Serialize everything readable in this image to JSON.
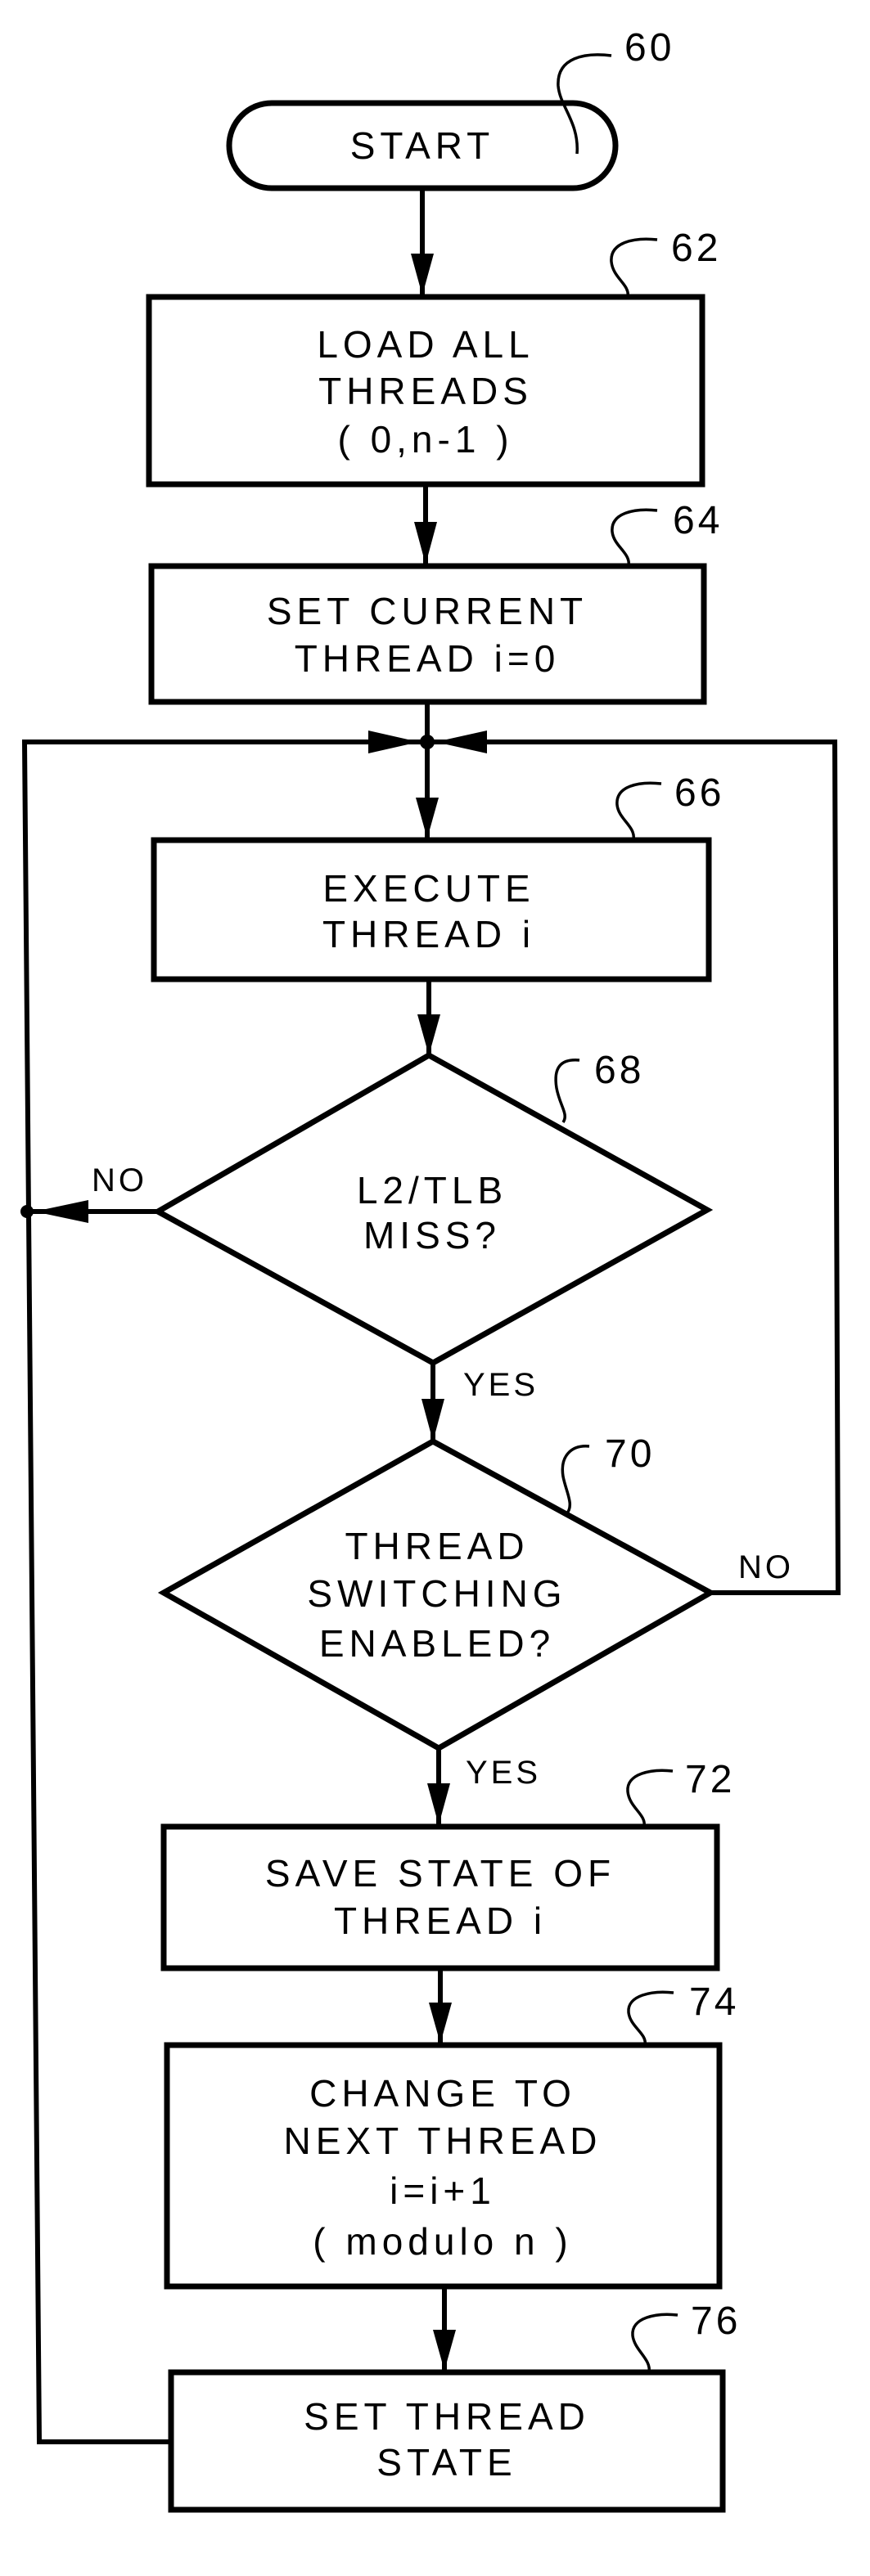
{
  "diagram": {
    "type": "flowchart",
    "nodes": [
      {
        "id": "60",
        "kind": "terminal",
        "ref": "60",
        "lines": [
          "START"
        ]
      },
      {
        "id": "62",
        "kind": "process",
        "ref": "62",
        "lines": [
          "LOAD ALL",
          "THREADS",
          "( 0,n-1 )"
        ]
      },
      {
        "id": "64",
        "kind": "process",
        "ref": "64",
        "lines": [
          "SET CURRENT",
          "THREAD i=0"
        ]
      },
      {
        "id": "66",
        "kind": "process",
        "ref": "66",
        "lines": [
          "EXECUTE",
          "THREAD i"
        ]
      },
      {
        "id": "68",
        "kind": "decision",
        "ref": "68",
        "lines": [
          "L2/TLB",
          "MISS?"
        ]
      },
      {
        "id": "70",
        "kind": "decision",
        "ref": "70",
        "lines": [
          "THREAD",
          "SWITCHING",
          "ENABLED?"
        ]
      },
      {
        "id": "72",
        "kind": "process",
        "ref": "72",
        "lines": [
          "SAVE STATE OF",
          "THREAD i"
        ]
      },
      {
        "id": "74",
        "kind": "process",
        "ref": "74",
        "lines": [
          "CHANGE TO",
          "NEXT THREAD",
          "i=i+1",
          "( modulo n )"
        ]
      },
      {
        "id": "76",
        "kind": "process",
        "ref": "76",
        "lines": [
          "SET THREAD",
          "STATE"
        ]
      }
    ],
    "edges": [
      {
        "from": "60",
        "to": "62",
        "label": ""
      },
      {
        "from": "62",
        "to": "64",
        "label": ""
      },
      {
        "from": "64",
        "to": "66",
        "label": ""
      },
      {
        "from": "66",
        "to": "68",
        "label": ""
      },
      {
        "from": "68",
        "to": "66",
        "label": "NO"
      },
      {
        "from": "68",
        "to": "70",
        "label": "YES"
      },
      {
        "from": "70",
        "to": "66",
        "label": "NO"
      },
      {
        "from": "70",
        "to": "72",
        "label": "YES"
      },
      {
        "from": "72",
        "to": "74",
        "label": ""
      },
      {
        "from": "74",
        "to": "76",
        "label": ""
      },
      {
        "from": "76",
        "to": "66",
        "label": ""
      }
    ],
    "branch_labels": {
      "d68_no": "NO",
      "d68_yes": "YES",
      "d70_no": "NO",
      "d70_yes": "YES"
    }
  }
}
